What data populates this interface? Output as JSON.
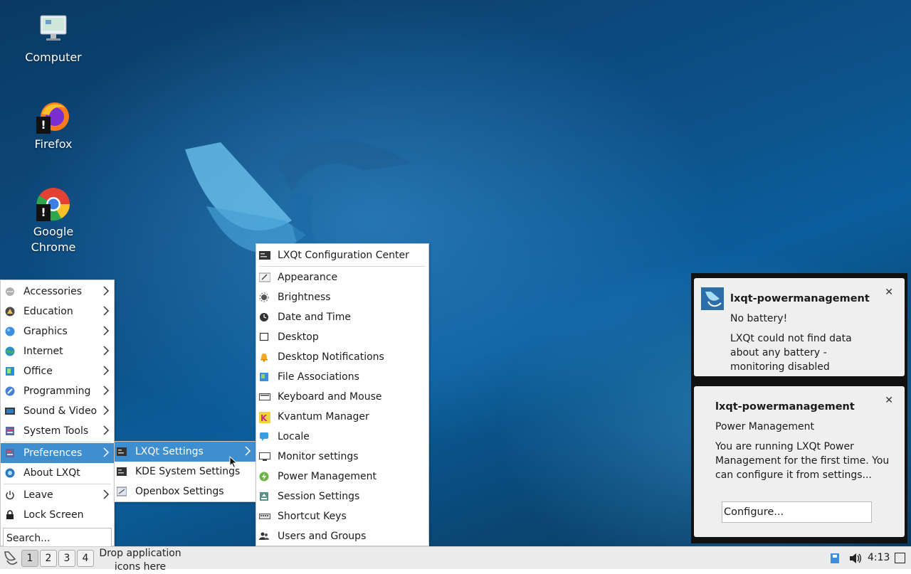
{
  "desktop": {
    "icons": [
      {
        "label": "Computer"
      },
      {
        "label": "Firefox"
      },
      {
        "label": "Google Chrome"
      }
    ]
  },
  "main_menu": {
    "items": [
      {
        "label": "Accessories",
        "icon": "accessories-icon",
        "submenu": true
      },
      {
        "label": "Education",
        "icon": "education-icon",
        "submenu": true
      },
      {
        "label": "Graphics",
        "icon": "graphics-icon",
        "submenu": true
      },
      {
        "label": "Internet",
        "icon": "internet-icon",
        "submenu": true
      },
      {
        "label": "Office",
        "icon": "office-icon",
        "submenu": true
      },
      {
        "label": "Programming",
        "icon": "programming-icon",
        "submenu": true
      },
      {
        "label": "Sound & Video",
        "icon": "sound-video-icon",
        "submenu": true
      },
      {
        "label": "System Tools",
        "icon": "system-tools-icon",
        "submenu": true
      },
      {
        "label": "Preferences",
        "icon": "preferences-icon",
        "submenu": true,
        "highlighted": true
      },
      {
        "label": "About LXQt",
        "icon": "about-icon"
      },
      {
        "label": "Leave",
        "icon": "power-icon",
        "submenu": true
      },
      {
        "label": "Lock Screen",
        "icon": "lock-icon"
      }
    ],
    "search_placeholder": "Search..."
  },
  "preferences_menu": {
    "items": [
      {
        "label": "LXQt Settings",
        "highlighted": true,
        "submenu": true
      },
      {
        "label": "KDE System Settings"
      },
      {
        "label": "Openbox Settings"
      }
    ]
  },
  "lxqt_settings_menu": {
    "items": [
      {
        "label": "LXQt Configuration Center",
        "icon": "configuration-center-icon"
      },
      {
        "label": "Appearance",
        "icon": "appearance-icon"
      },
      {
        "label": "Brightness",
        "icon": "brightness-icon"
      },
      {
        "label": "Date and Time",
        "icon": "clock-icon"
      },
      {
        "label": "Desktop",
        "icon": "desktop-icon"
      },
      {
        "label": "Desktop Notifications",
        "icon": "bell-icon"
      },
      {
        "label": "File Associations",
        "icon": "file-associations-icon"
      },
      {
        "label": "Keyboard and Mouse",
        "icon": "keyboard-icon"
      },
      {
        "label": "Kvantum Manager",
        "icon": "kvantum-icon"
      },
      {
        "label": "Locale",
        "icon": "locale-icon"
      },
      {
        "label": "Monitor settings",
        "icon": "monitor-icon"
      },
      {
        "label": "Power Management",
        "icon": "power-management-icon"
      },
      {
        "label": "Session Settings",
        "icon": "session-icon"
      },
      {
        "label": "Shortcut Keys",
        "icon": "shortcut-keys-icon"
      },
      {
        "label": "Users and Groups",
        "icon": "users-icon"
      }
    ]
  },
  "notifications": [
    {
      "app": "lxqt-powermanagement",
      "summary": "No battery!",
      "body": "LXQt could not find data about any battery - monitoring disabled"
    },
    {
      "app": "lxqt-powermanagement",
      "summary": "Power Management",
      "body": "You are running LXQt Power Management for the first time. You can configure it from settings...",
      "action": "Configure..."
    }
  ],
  "taskbar": {
    "workspaces": [
      "1",
      "2",
      "3",
      "4"
    ],
    "active_workspace": "1",
    "drop_hint": "Drop application icons here",
    "clock": "4:13"
  },
  "colors": {
    "menu_highlight": "#3f8fd0",
    "desktop_blue": "#0d4f86"
  }
}
